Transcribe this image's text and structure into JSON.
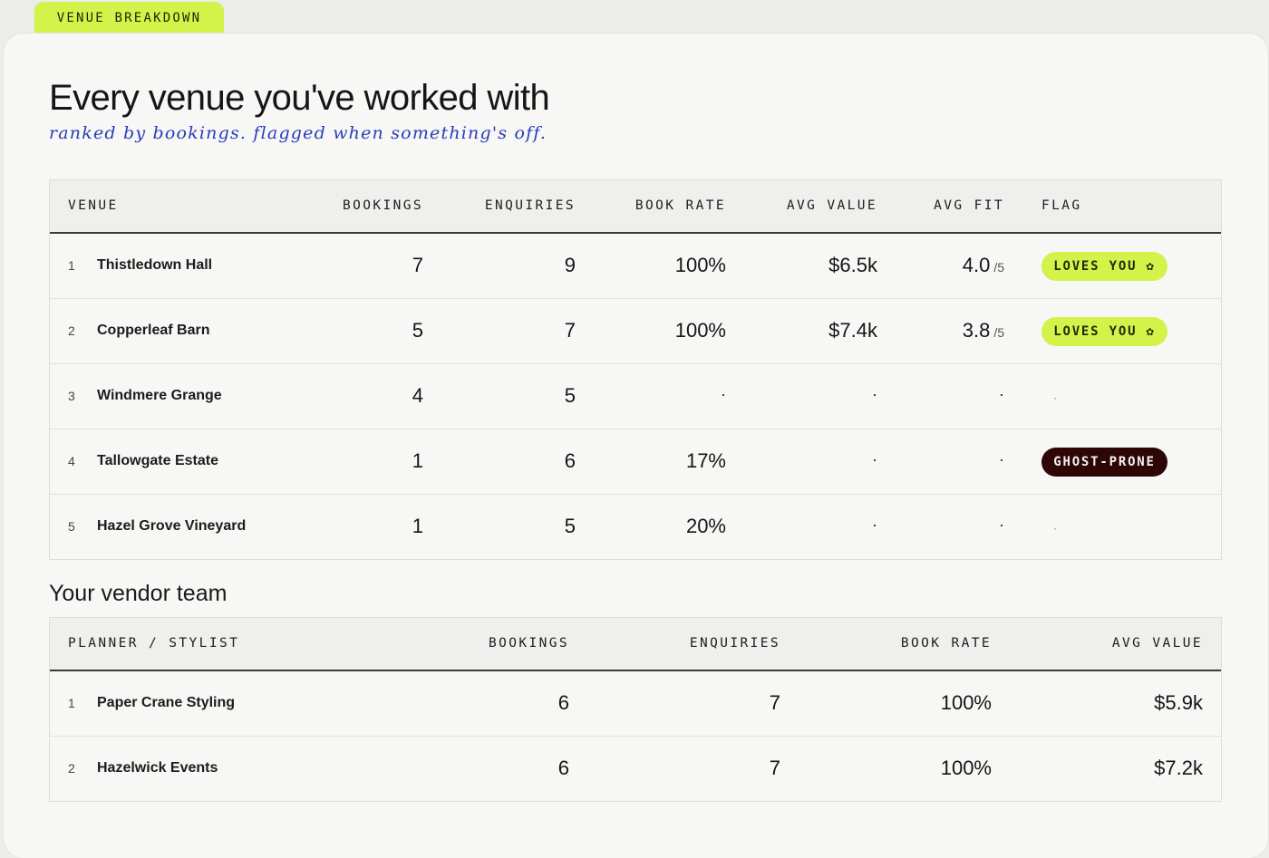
{
  "tab_label": "VENUE BREAKDOWN",
  "title": "Every venue you've worked with",
  "subtitle": "ranked by bookings. flagged when something's off.",
  "colors": {
    "accent": "#d3f24a",
    "ghost": "#2e0606",
    "subtitle": "#2a3bb8"
  },
  "venues": {
    "headers": [
      "VENUE",
      "BOOKINGS",
      "ENQUIRIES",
      "BOOK RATE",
      "AVG VALUE",
      "AVG FIT",
      "FLAG"
    ],
    "rows": [
      {
        "rank": "1",
        "name": "Thistledown Hall",
        "bookings": "7",
        "enquiries": "9",
        "book_rate": "100%",
        "avg_value": "$6.5k",
        "fit": "4.0",
        "fit_den": "/5",
        "flag": "LOVES YOU ✿",
        "flag_type": "love"
      },
      {
        "rank": "2",
        "name": "Copperleaf Barn",
        "bookings": "5",
        "enquiries": "7",
        "book_rate": "100%",
        "avg_value": "$7.4k",
        "fit": "3.8",
        "fit_den": "/5",
        "flag": "LOVES YOU ✿",
        "flag_type": "love"
      },
      {
        "rank": "3",
        "name": "Windmere Grange",
        "bookings": "4",
        "enquiries": "5",
        "book_rate": "·",
        "avg_value": "·",
        "fit": "·",
        "fit_den": "",
        "flag": "·",
        "flag_type": "none"
      },
      {
        "rank": "4",
        "name": "Tallowgate Estate",
        "bookings": "1",
        "enquiries": "6",
        "book_rate": "17%",
        "avg_value": "·",
        "fit": "·",
        "fit_den": "",
        "flag": "GHOST-PRONE",
        "flag_type": "ghost"
      },
      {
        "rank": "5",
        "name": "Hazel Grove Vineyard",
        "bookings": "1",
        "enquiries": "5",
        "book_rate": "20%",
        "avg_value": "·",
        "fit": "·",
        "fit_den": "",
        "flag": "·",
        "flag_type": "none"
      }
    ]
  },
  "vendor_section_title": "Your vendor team",
  "vendors": {
    "headers": [
      "PLANNER / STYLIST",
      "BOOKINGS",
      "ENQUIRIES",
      "BOOK RATE",
      "AVG VALUE"
    ],
    "rows": [
      {
        "rank": "1",
        "name": "Paper Crane Styling",
        "bookings": "6",
        "enquiries": "7",
        "book_rate": "100%",
        "avg_value": "$5.9k"
      },
      {
        "rank": "2",
        "name": "Hazelwick Events",
        "bookings": "6",
        "enquiries": "7",
        "book_rate": "100%",
        "avg_value": "$7.2k"
      }
    ]
  }
}
